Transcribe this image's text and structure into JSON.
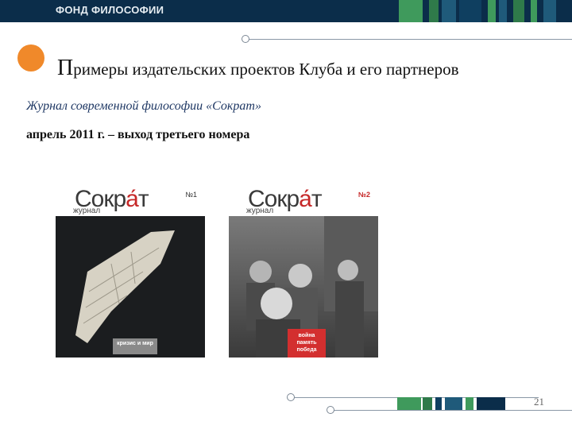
{
  "header": {
    "brand": "ФОНД ФИЛОСОФИИ"
  },
  "slide": {
    "title_cap": "П",
    "title_rest": "римеры издательских проектов Клуба и его партнеров",
    "line1": "Журнал современной философии «Сократ»",
    "line2": "апрель 2011 г. –  выход третьего номера"
  },
  "covers": [
    {
      "logo_a": "Сокр",
      "logo_accent": "а́",
      "logo_b": "т",
      "subtitle": "журнал",
      "issue": "№1",
      "badge": "кризис и мир"
    },
    {
      "logo_a": "Сокр",
      "logo_accent": "а́",
      "logo_b": "т",
      "subtitle": "журнал",
      "issue": "№2",
      "badge": "война память победа"
    }
  ],
  "footer": {
    "page_number": "21"
  },
  "colors": {
    "navy": "#0b2d4a",
    "green": "#3f9a5c",
    "orange": "#f0892a"
  }
}
